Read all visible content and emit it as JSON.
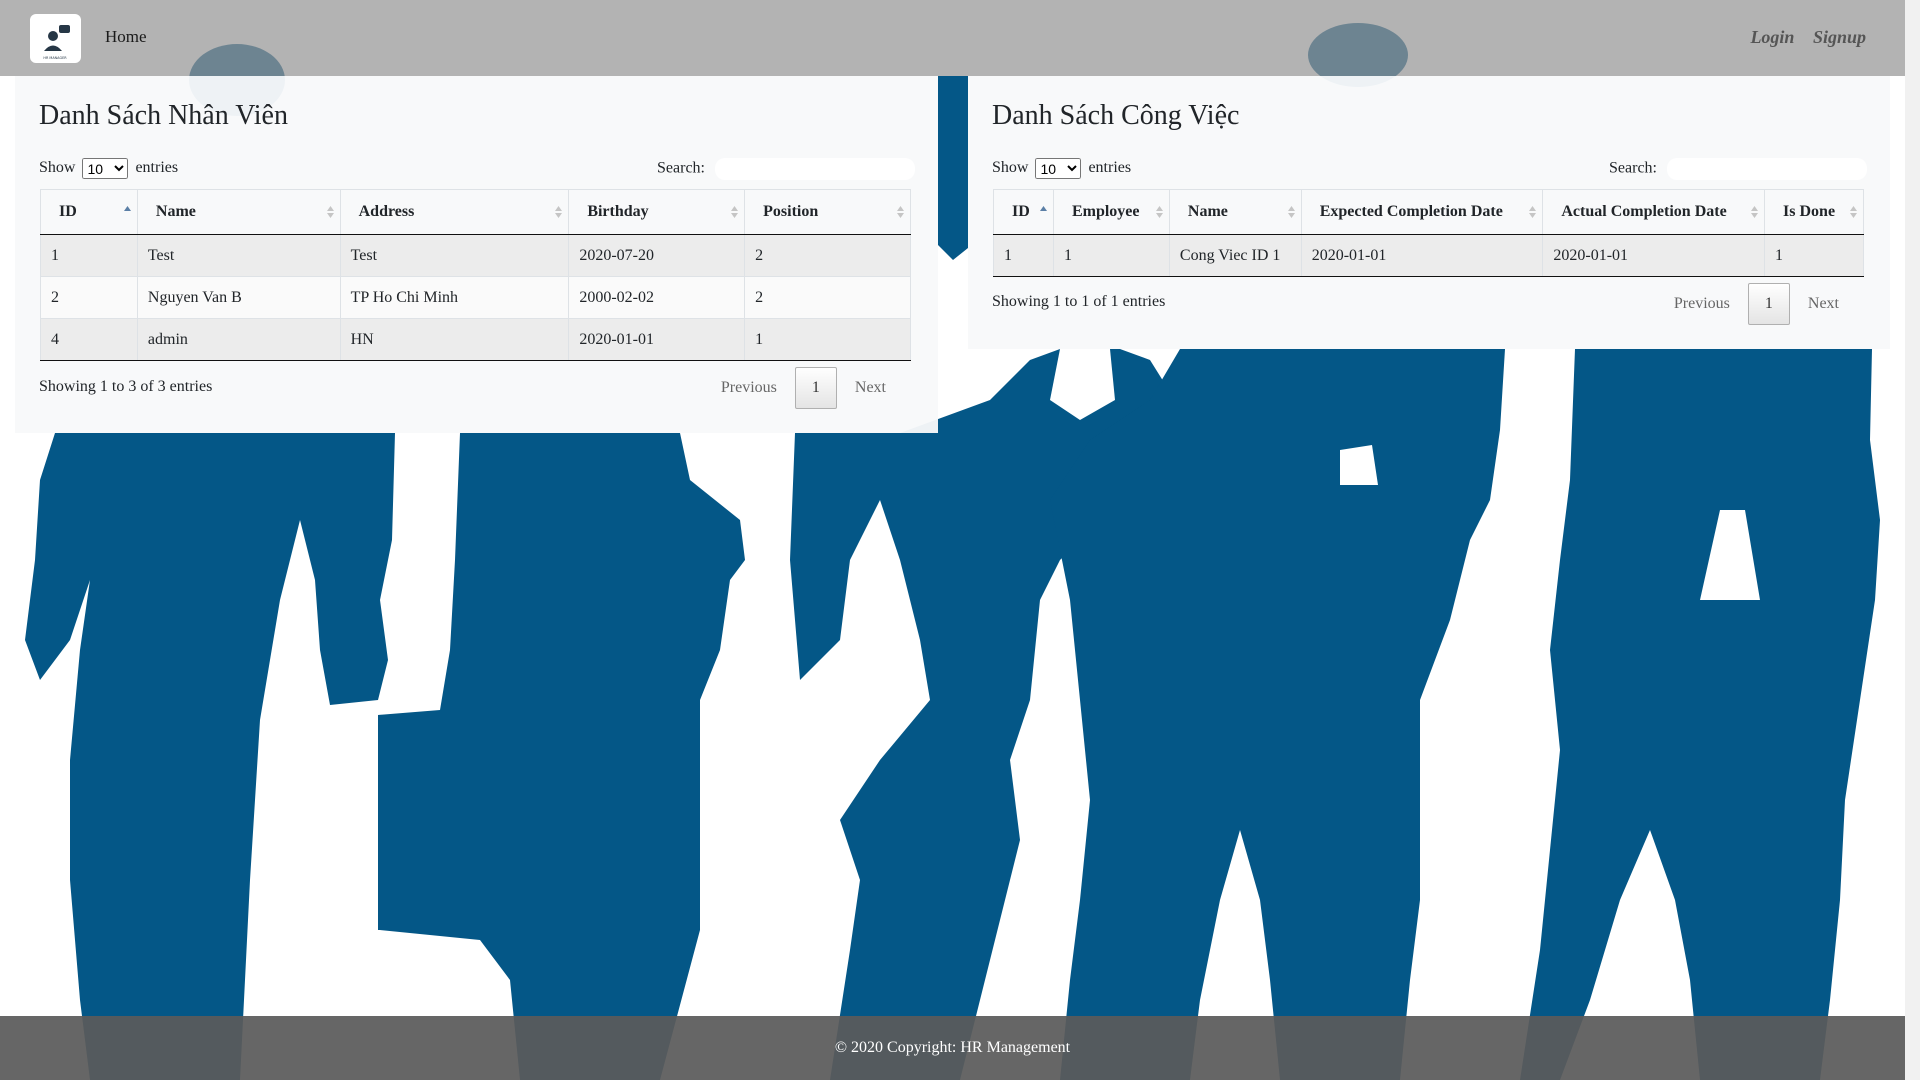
{
  "nav": {
    "home": "Home",
    "login": "Login",
    "signup": "Signup"
  },
  "employees": {
    "title": "Danh Sách Nhân Viên",
    "show_label": "Show",
    "entries_label": "entries",
    "page_length": "10",
    "search_label": "Search:",
    "columns": [
      "ID",
      "Name",
      "Address",
      "Birthday",
      "Position"
    ],
    "rows": [
      [
        "1",
        "Test",
        "Test",
        "2020-07-20",
        "2"
      ],
      [
        "2",
        "Nguyen Van B",
        "TP Ho Chi Minh",
        "2000-02-02",
        "2"
      ],
      [
        "4",
        "admin",
        "HN",
        "2020-01-01",
        "1"
      ]
    ],
    "info": "Showing 1 to 3 of 3 entries",
    "prev": "Previous",
    "page": "1",
    "next": "Next"
  },
  "tasks": {
    "title": "Danh Sách Công Việc",
    "show_label": "Show",
    "entries_label": "entries",
    "page_length": "10",
    "search_label": "Search:",
    "columns": [
      "ID",
      "Employee",
      "Name",
      "Expected Completion Date",
      "Actual Completion Date",
      "Is Done"
    ],
    "rows": [
      [
        "1",
        "1",
        "Cong Viec ID 1",
        "2020-01-01",
        "2020-01-01",
        "1"
      ]
    ],
    "info": "Showing 1 to 1 of 1 entries",
    "prev": "Previous",
    "page": "1",
    "next": "Next"
  },
  "footer": {
    "text": "© 2020 Copyright: HR Management"
  },
  "colors": {
    "silhouette": "#045787",
    "navbar": "#a0a0a0",
    "footer": "#5a5a5a"
  },
  "icons": {
    "logo": "hr-manager-logo",
    "sort_asc": "sort-asc-icon",
    "sort_both": "sort-both-icon"
  }
}
